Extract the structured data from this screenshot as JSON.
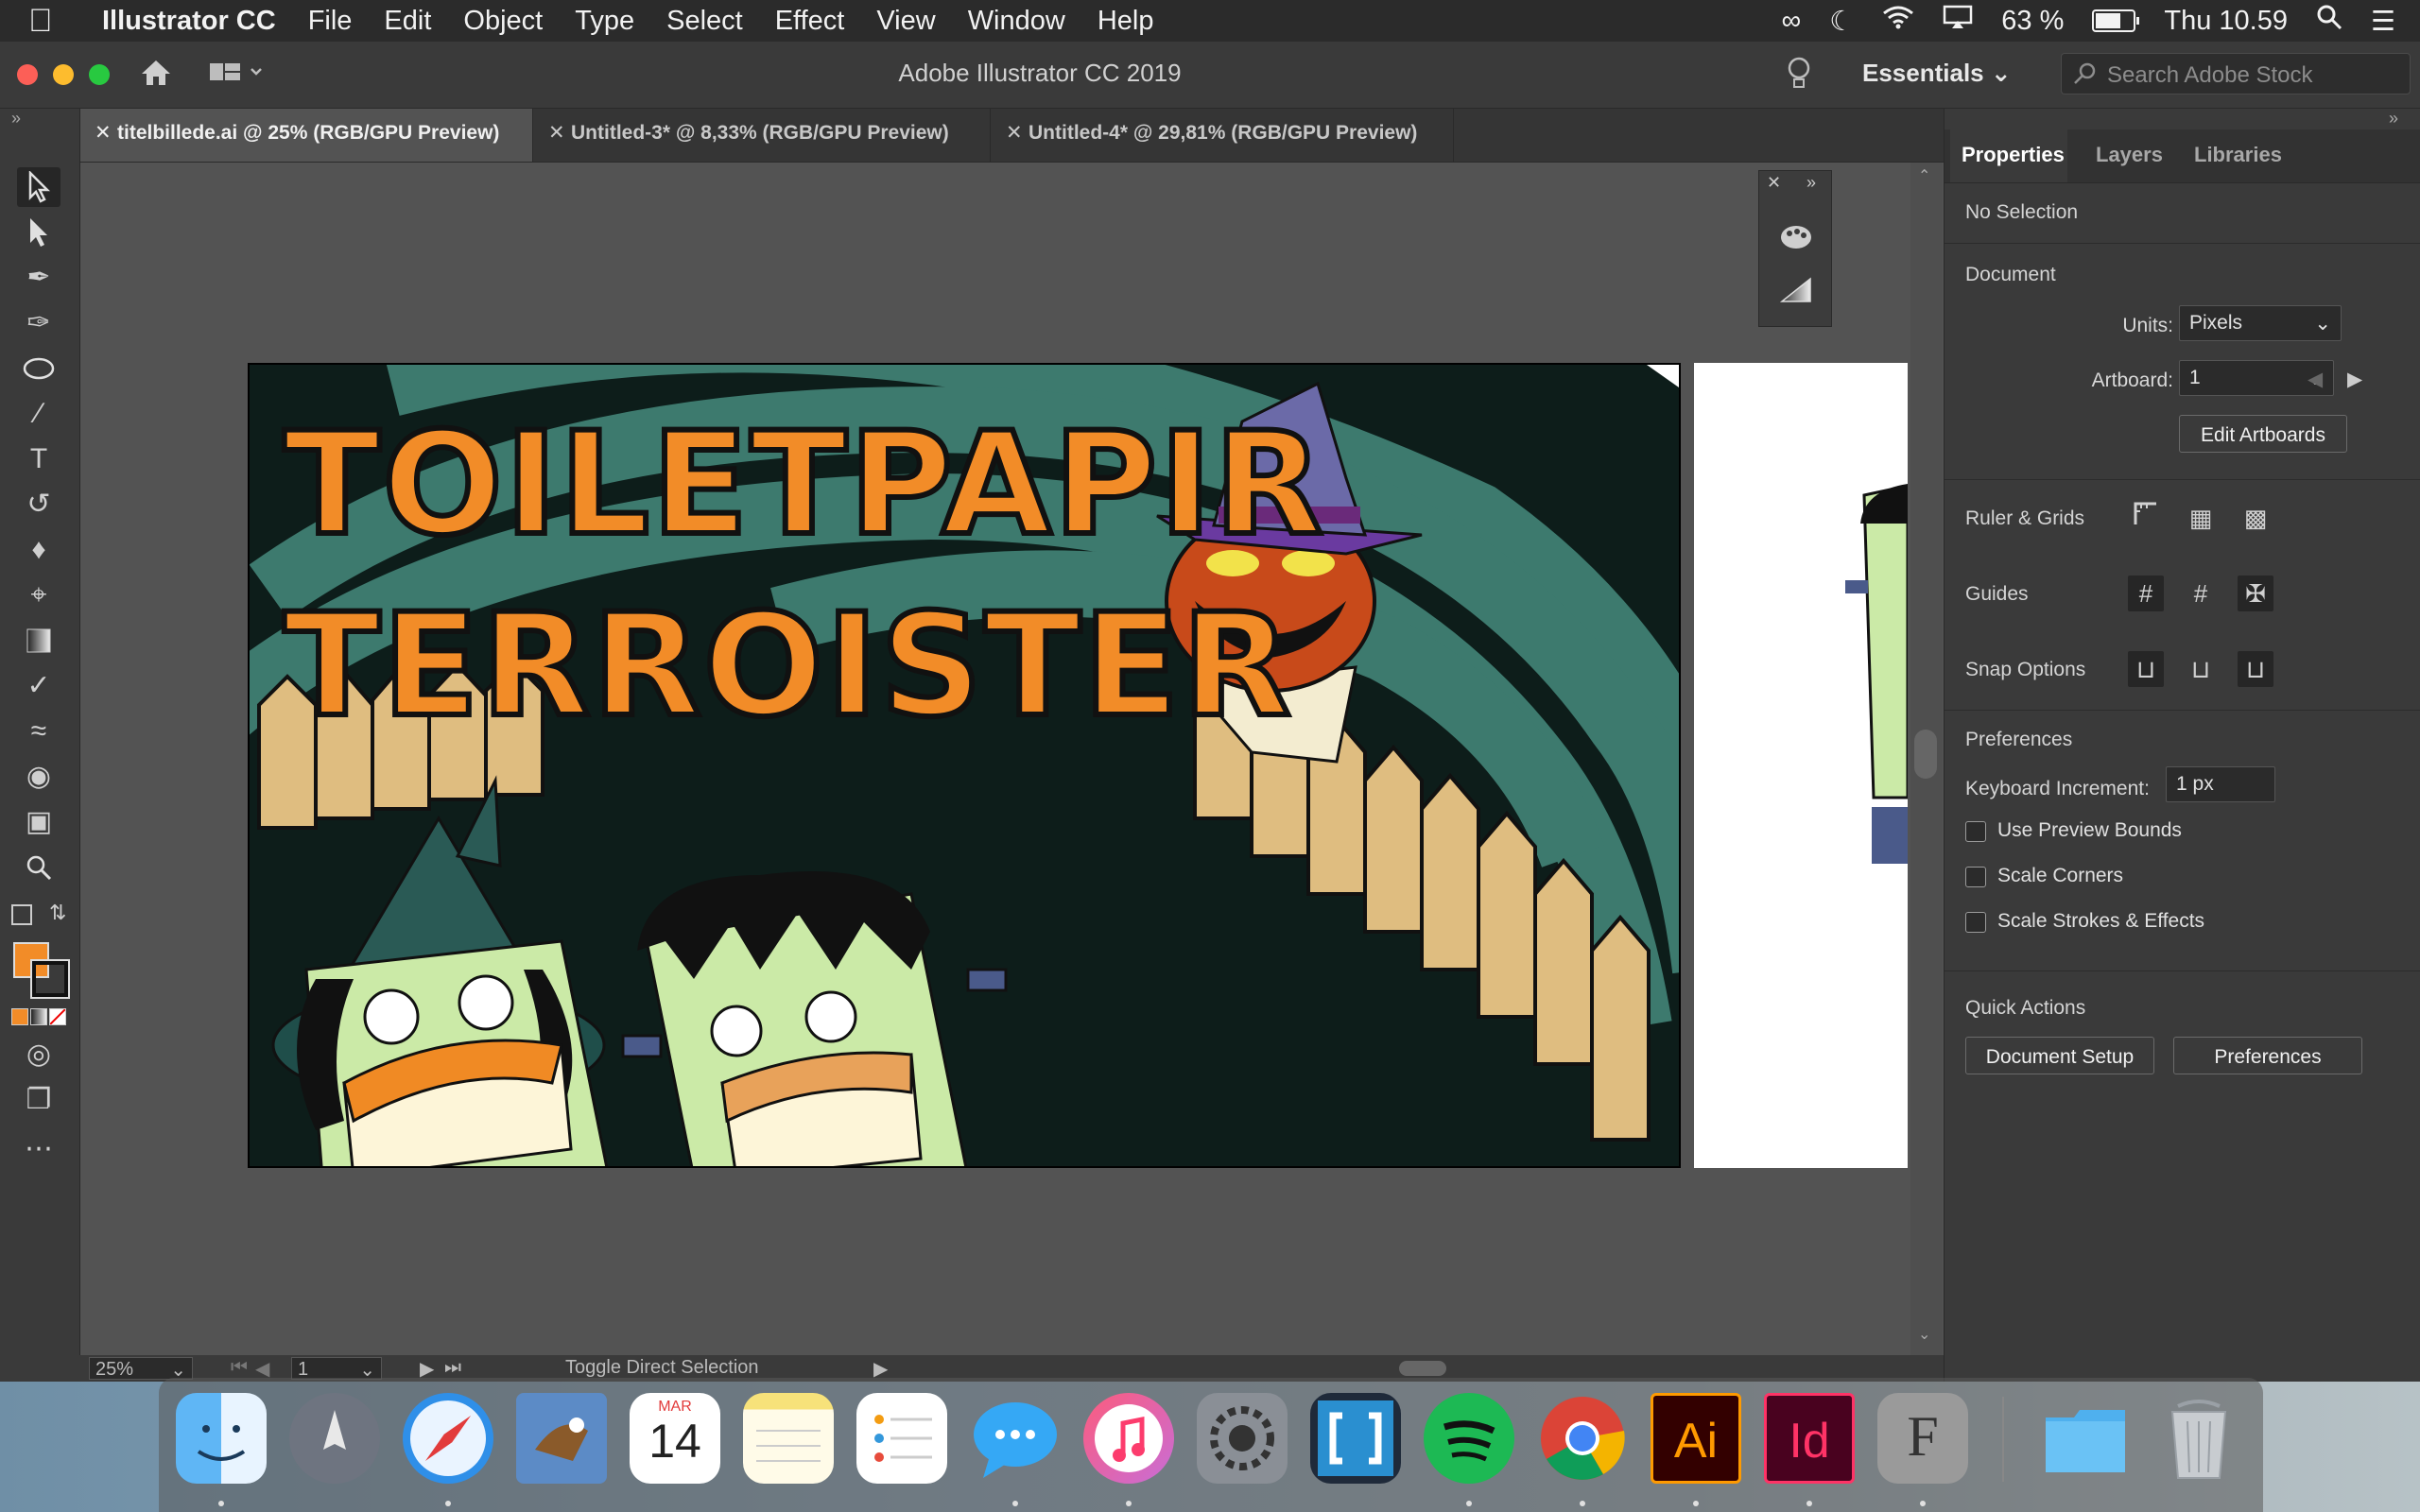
{
  "menubar": {
    "app_name": "Illustrator CC",
    "items": [
      "File",
      "Edit",
      "Object",
      "Type",
      "Select",
      "Effect",
      "View",
      "Window",
      "Help"
    ],
    "battery": "63 %",
    "clock": "Thu 10.59"
  },
  "window": {
    "title": "Adobe Illustrator CC 2019",
    "workspace": "Essentials",
    "stock_search_placeholder": "Search Adobe Stock"
  },
  "tabs": [
    {
      "label": "titelbillede.ai @ 25% (RGB/GPU Preview)"
    },
    {
      "label": "Untitled-3* @ 8,33% (RGB/GPU Preview)"
    },
    {
      "label": "Untitled-4* @ 29,81% (RGB/GPU Preview)"
    }
  ],
  "artwork": {
    "title_line1": "TOILETPAPIR",
    "title_line2": "TERROISTER"
  },
  "statusbar": {
    "zoom": "25%",
    "artboard": "1",
    "tool_hint": "Toggle Direct Selection"
  },
  "properties": {
    "tabs": [
      "Properties",
      "Layers",
      "Libraries"
    ],
    "no_selection": "No Selection",
    "document_heading": "Document",
    "units_label": "Units:",
    "units_value": "Pixels",
    "artboard_label": "Artboard:",
    "artboard_value": "1",
    "edit_artboards": "Edit Artboards",
    "ruler_grids": "Ruler & Grids",
    "guides": "Guides",
    "snap_options": "Snap Options",
    "preferences_heading": "Preferences",
    "keyboard_increment_label": "Keyboard Increment:",
    "keyboard_increment_value": "1 px",
    "checkboxes": [
      "Use Preview Bounds",
      "Scale Corners",
      "Scale Strokes & Effects"
    ],
    "quick_actions": "Quick Actions",
    "document_setup": "Document Setup",
    "preferences_button": "Preferences"
  },
  "dock": {
    "calendar_month": "MAR",
    "calendar_day": "14",
    "ai_label": "Ai",
    "id_label": "Id",
    "fontbook_label": "F"
  },
  "colors": {
    "fill_swatch": "#f28c28",
    "ai_brand": "#ff9a00",
    "id_brand": "#ff3366"
  }
}
